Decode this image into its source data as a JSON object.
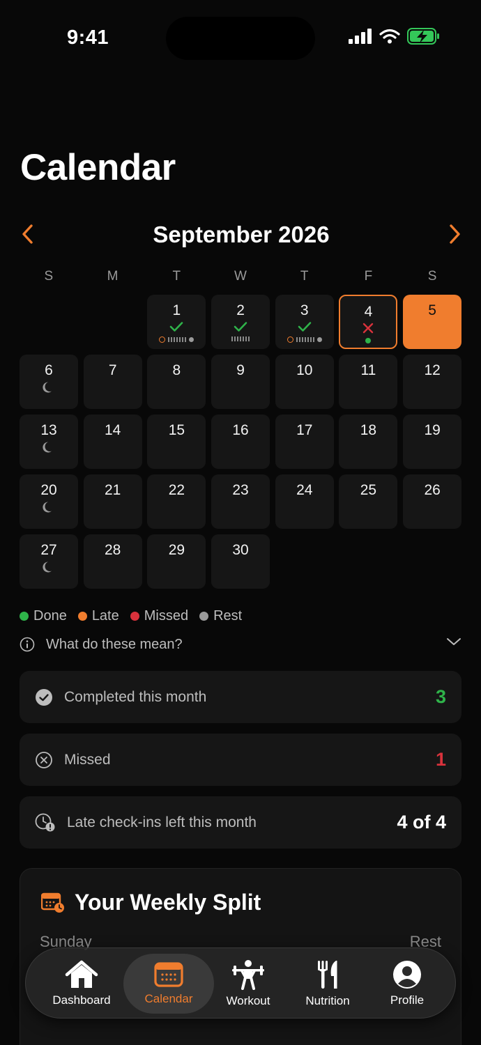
{
  "status_bar": {
    "time": "9:41"
  },
  "page_title": "Calendar",
  "month_nav": {
    "label": "September 2026",
    "accent": "#f07d2e"
  },
  "weekdays": [
    "S",
    "M",
    "T",
    "W",
    "T",
    "F",
    "S"
  ],
  "calendar": {
    "days": [
      "1",
      "2",
      "3",
      "4",
      "5",
      "6",
      "7",
      "8",
      "9",
      "10",
      "11",
      "12",
      "13",
      "14",
      "15",
      "16",
      "17",
      "18",
      "19",
      "20",
      "21",
      "22",
      "23",
      "24",
      "25",
      "26",
      "27",
      "28",
      "29",
      "30"
    ]
  },
  "legend": {
    "done": "Done",
    "late": "Late",
    "missed": "Missed",
    "rest": "Rest",
    "colors": {
      "done": "#2fb34a",
      "late": "#f07d2e",
      "missed": "#d8323c",
      "rest": "#9a9a9a"
    }
  },
  "info": {
    "label": "What do these mean?"
  },
  "stats": {
    "completed": {
      "label": "Completed this month",
      "value": "3",
      "color": "#2fb34a"
    },
    "missed": {
      "label": "Missed",
      "value": "1",
      "color": "#d8323c"
    },
    "late": {
      "label": "Late check-ins left this month",
      "value": "4 of 4"
    }
  },
  "split": {
    "title": "Your Weekly Split",
    "rows": [
      {
        "day": "Sunday",
        "plan": "Rest"
      }
    ]
  },
  "tabbar": {
    "dashboard": "Dashboard",
    "calendar": "Calendar",
    "workout": "Workout",
    "nutrition": "Nutrition",
    "profile": "Profile"
  }
}
